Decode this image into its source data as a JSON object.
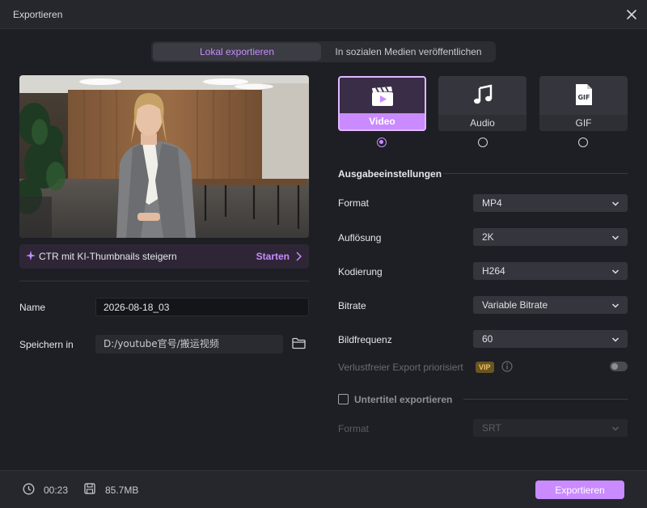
{
  "window": {
    "title": "Exportieren"
  },
  "tabs": [
    {
      "label": "Lokal exportieren",
      "active": true
    },
    {
      "label": "In sozialen Medien veröffentlichen",
      "active": false
    }
  ],
  "ctr": {
    "text": "CTR mit KI-Thumbnails steigern",
    "action": "Starten"
  },
  "fields": {
    "name_label": "Name",
    "name_value": "2026-08-18_03",
    "save_label": "Speichern in",
    "save_path": "D:/youtube官号/搬运视频"
  },
  "types": [
    {
      "label": "Video",
      "icon": "video-clapper-icon",
      "selected": true
    },
    {
      "label": "Audio",
      "icon": "music-note-icon",
      "selected": false
    },
    {
      "label": "GIF",
      "icon": "gif-icon",
      "selected": false
    }
  ],
  "output": {
    "title": "Ausgabeeinstellungen",
    "rows": [
      {
        "label": "Format",
        "value": "MP4"
      },
      {
        "label": "Auflösung",
        "value": "2K"
      },
      {
        "label": "Kodierung",
        "value": "H264"
      },
      {
        "label": "Bitrate",
        "value": "Variable Bitrate"
      },
      {
        "label": "Bildfrequenz",
        "value": "60"
      }
    ],
    "lossless_label": "Verlustfreier Export priorisiert",
    "vip_badge": "VIP",
    "lossless_enabled": false
  },
  "subtitles": {
    "label": "Untertitel exportieren",
    "checked": false,
    "format_label": "Format",
    "format_value": "SRT"
  },
  "footer": {
    "duration": "00:23",
    "size": "85.7MB",
    "export_label": "Exportieren"
  },
  "colors": {
    "accent": "#c98bff",
    "background": "#1e1f24",
    "panel": "#26272d"
  }
}
